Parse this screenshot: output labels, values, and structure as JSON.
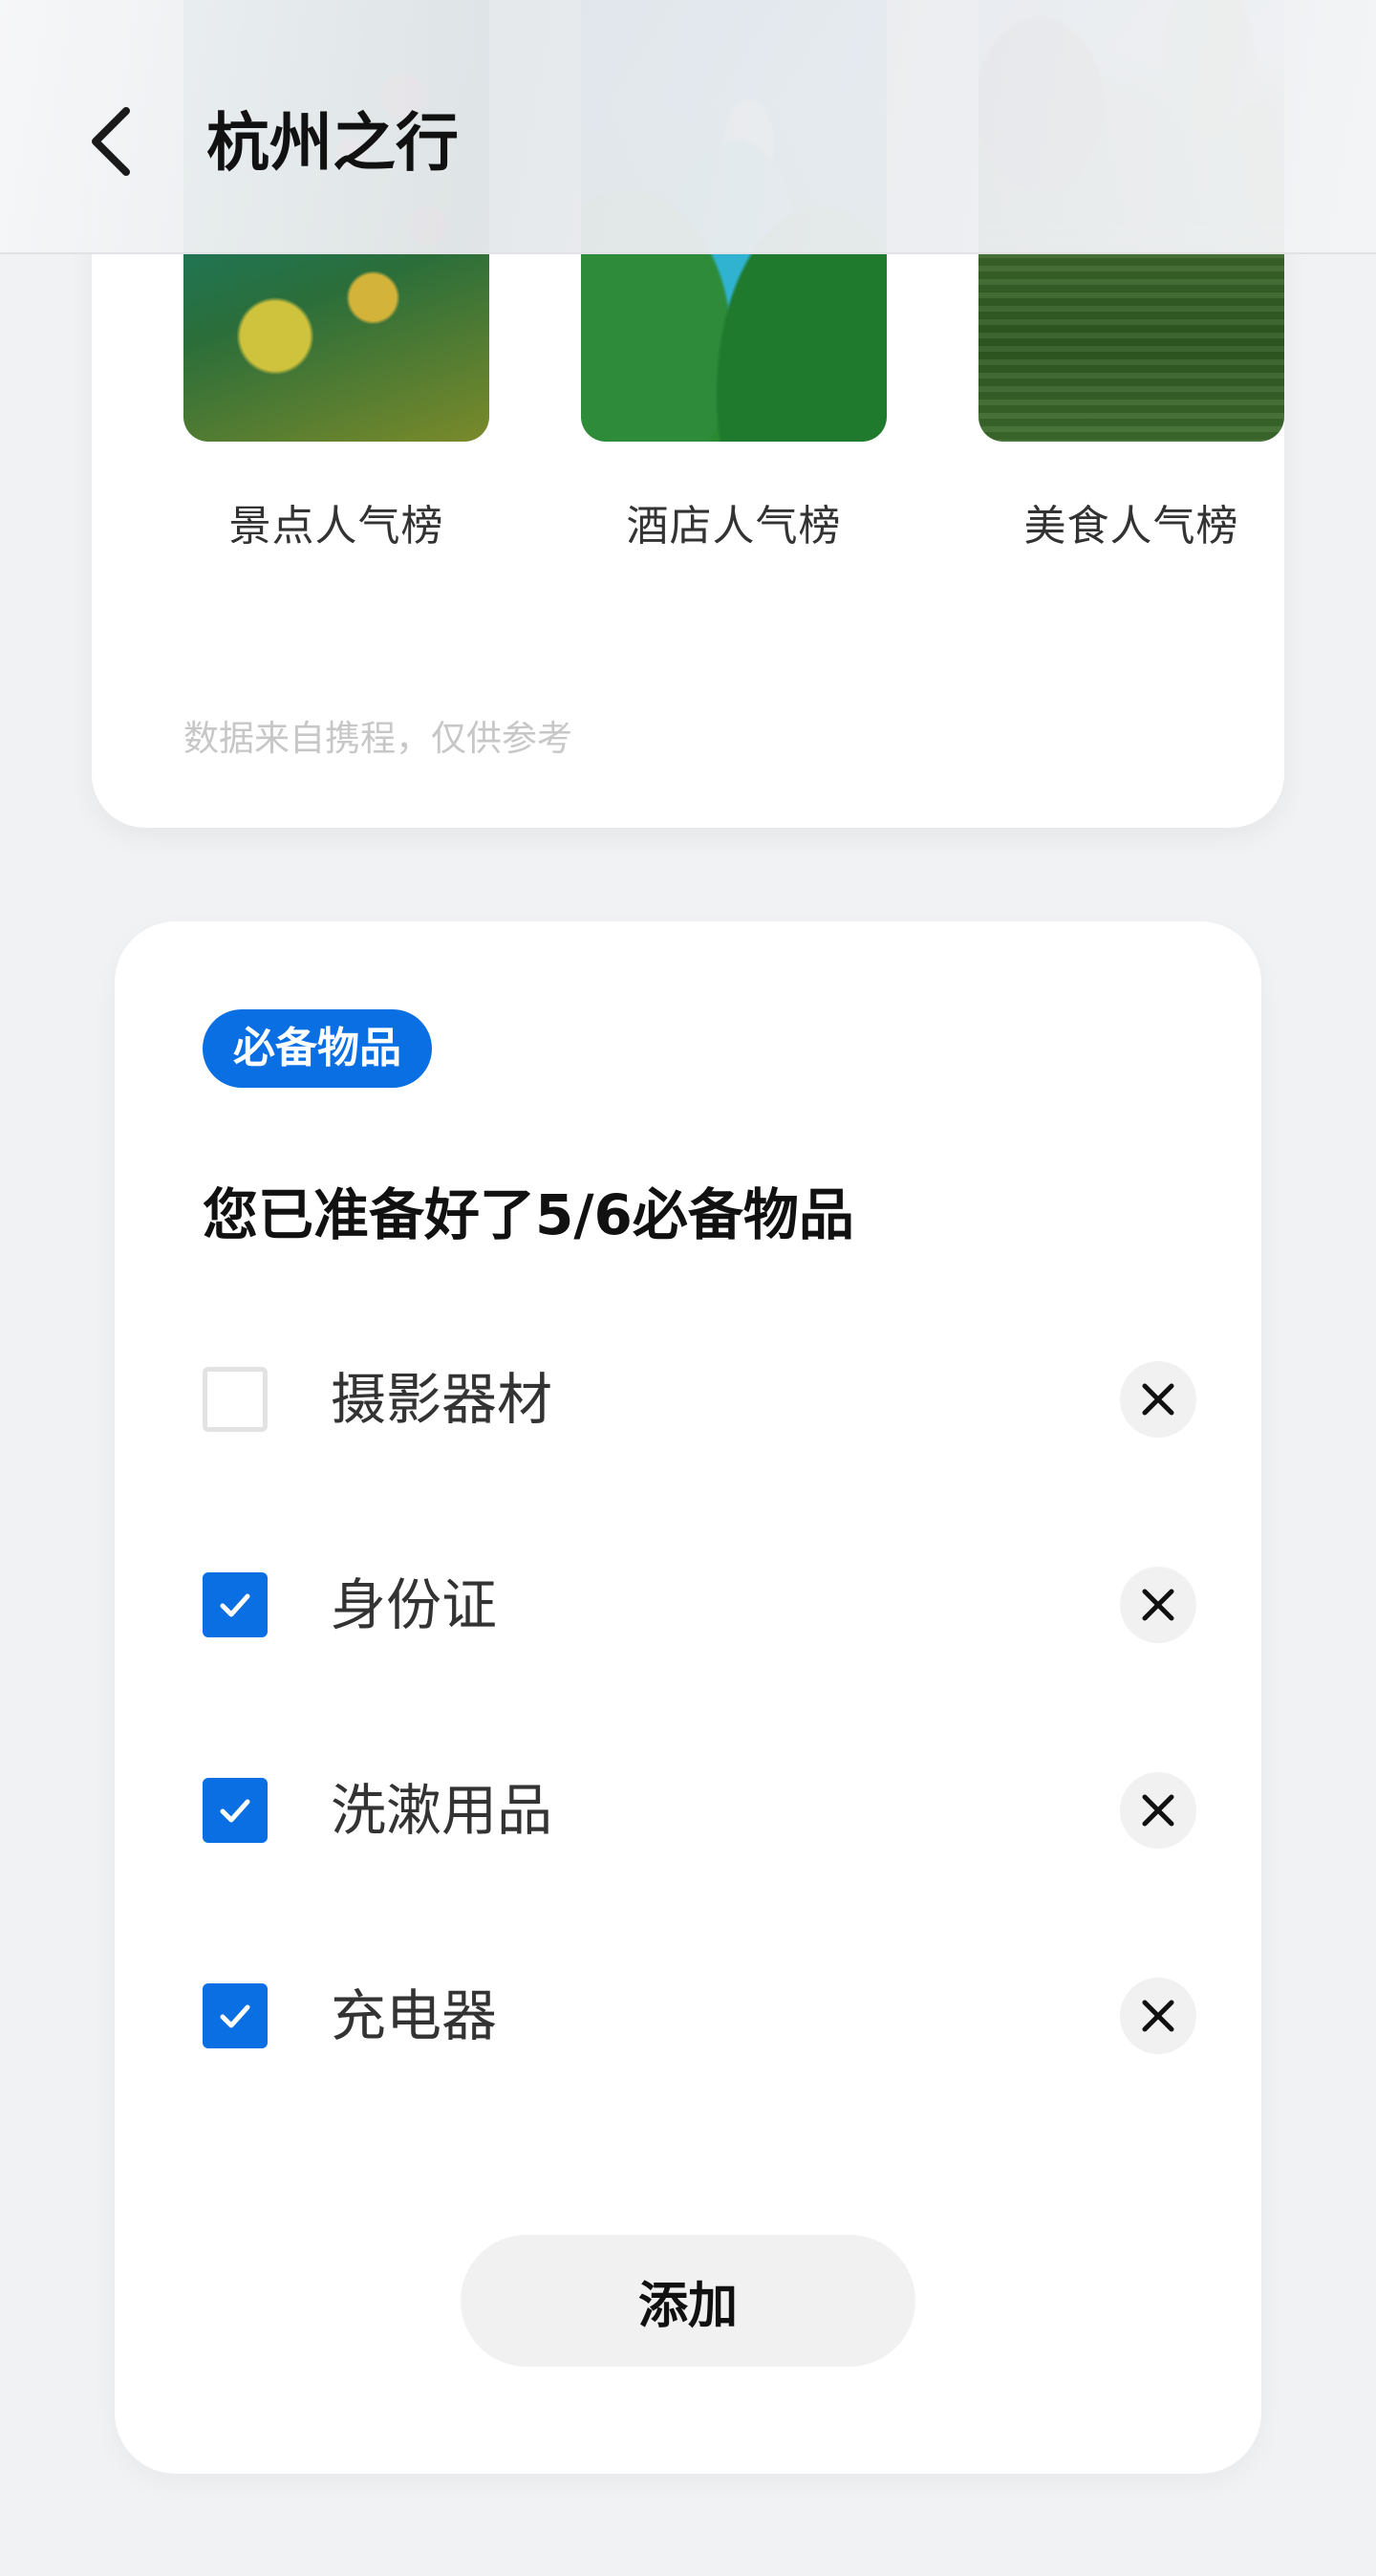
{
  "header": {
    "title": "杭州之行",
    "back_icon": "chevron-left-icon"
  },
  "rankings": {
    "items": [
      {
        "label": "景点人气榜",
        "image": "scenic-photo"
      },
      {
        "label": "酒店人气榜",
        "image": "hotel-photo"
      },
      {
        "label": "美食人气榜",
        "image": "food-photo"
      }
    ],
    "note": "数据来自携程，仅供参考"
  },
  "essentials": {
    "badge": "必备物品",
    "summary": "您已准备好了5/6必备物品",
    "items": [
      {
        "label": "摄影器材",
        "checked": false
      },
      {
        "label": "身份证",
        "checked": true
      },
      {
        "label": "洗漱用品",
        "checked": true
      },
      {
        "label": "充电器",
        "checked": true
      }
    ],
    "add_label": "添加"
  },
  "colors": {
    "accent": "#0a6fe2",
    "background": "#f1f2f4"
  }
}
